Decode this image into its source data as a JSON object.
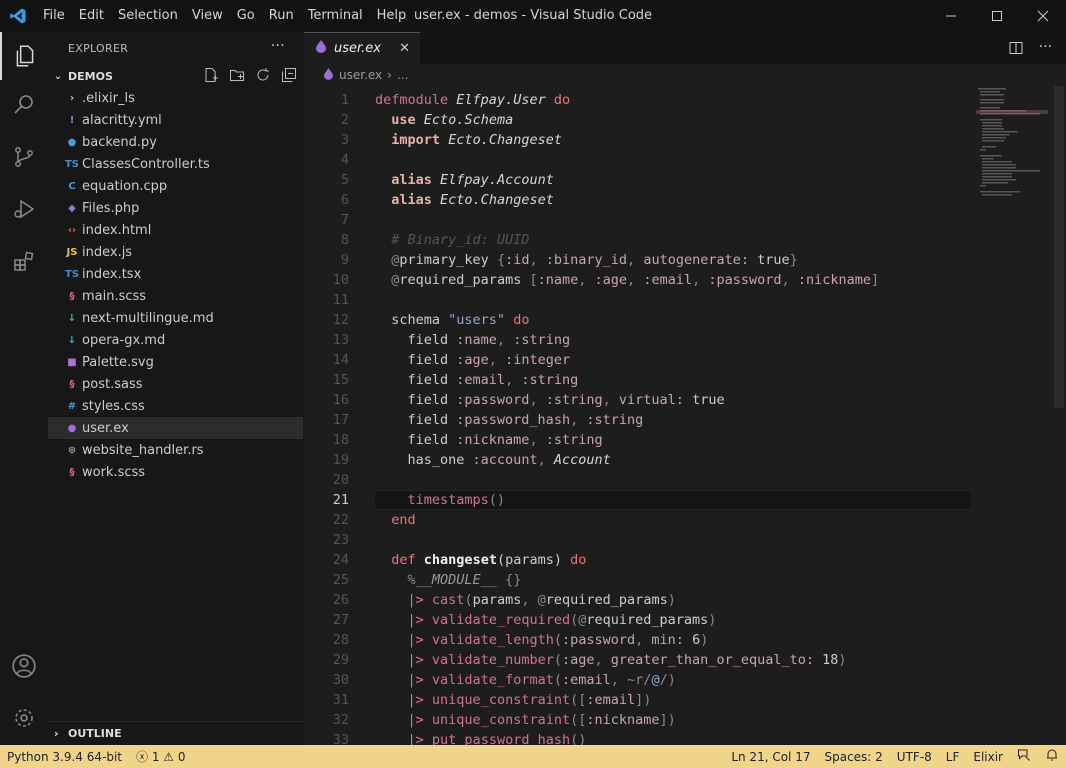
{
  "window": {
    "title": "user.ex - demos - Visual Studio Code"
  },
  "menu": [
    "File",
    "Edit",
    "Selection",
    "View",
    "Go",
    "Run",
    "Terminal",
    "Help"
  ],
  "explorer": {
    "header": "EXPLORER",
    "folder": "DEMOS",
    "files": [
      {
        "name": ".elixir_ls",
        "icon": "chevron-right",
        "color": "#cccccc"
      },
      {
        "name": "alacritty.yml",
        "icon": "exclamation",
        "color": "#9b7fd4"
      },
      {
        "name": "backend.py",
        "icon": "python",
        "color": "#4a9bd4"
      },
      {
        "name": "ClassesController.ts",
        "icon": "TS",
        "color": "#3b8fcf"
      },
      {
        "name": "equation.cpp",
        "icon": "C",
        "color": "#4a90d9"
      },
      {
        "name": "Files.php",
        "icon": "php",
        "color": "#8a7fd4"
      },
      {
        "name": "index.html",
        "icon": "<>",
        "color": "#e5674b"
      },
      {
        "name": "index.js",
        "icon": "JS",
        "color": "#e8c547"
      },
      {
        "name": "index.tsx",
        "icon": "TS",
        "color": "#3b8fcf"
      },
      {
        "name": "main.scss",
        "icon": "sass",
        "color": "#d9689b"
      },
      {
        "name": "next-multilingue.md",
        "icon": "down-arrow",
        "color": "#4aa5d9"
      },
      {
        "name": "opera-gx.md",
        "icon": "down-arrow",
        "color": "#4aa5d9"
      },
      {
        "name": "Palette.svg",
        "icon": "svg",
        "color": "#b06fd9"
      },
      {
        "name": "post.sass",
        "icon": "sass",
        "color": "#d9689b"
      },
      {
        "name": "styles.css",
        "icon": "#",
        "color": "#4a9bd4"
      },
      {
        "name": "user.ex",
        "icon": "drop",
        "color": "#9b6fd4",
        "selected": true
      },
      {
        "name": "website_handler.rs",
        "icon": "rust",
        "color": "#999999"
      },
      {
        "name": "work.scss",
        "icon": "sass",
        "color": "#d9689b"
      }
    ],
    "outline": "OUTLINE"
  },
  "tab": {
    "label": "user.ex",
    "close": "✕"
  },
  "breadcrumb": {
    "file": "user.ex",
    "rest": "..."
  },
  "code": {
    "current_line": 21,
    "lines": [
      "<span class='f'>defmodule</span> <span class='t'>Elfpay.User</span> <span class='k'>do</span>",
      "  <span class='kw'>use</span> <span class='t'>Ecto.Schema</span>",
      "  <span class='kw'>import</span> <span class='t'>Ecto.Changeset</span>",
      "",
      "  <span class='kw'>alias</span> <span class='t'>Elfpay.Account</span>",
      "  <span class='kw'>alias</span> <span class='t'>Ecto.Changeset</span>",
      "",
      "  <span class='cm'># Binary_id: UUID</span>",
      "  <span class='p'>@</span>primary_key <span class='p'>{</span><span class='a'>:id</span><span class='p'>,</span> <span class='a'>:binary_id</span><span class='p'>,</span> <span class='a'>autogenerate:</span> true<span class='p'>}</span>",
      "  <span class='p'>@</span>required_params <span class='p'>[</span><span class='a'>:name</span><span class='p'>,</span> <span class='a'>:age</span><span class='p'>,</span> <span class='a'>:email</span><span class='p'>,</span> <span class='a'>:password</span><span class='p'>,</span> <span class='a'>:nickname</span><span class='p'>]</span>",
      "",
      "  schema <span class='s'>\"users\"</span> <span class='k'>do</span>",
      "    field <span class='a'>:name</span><span class='p'>,</span> <span class='a'>:string</span>",
      "    field <span class='a'>:age</span><span class='p'>,</span> <span class='a'>:integer</span>",
      "    field <span class='a'>:email</span><span class='p'>,</span> <span class='a'>:string</span>",
      "    field <span class='a'>:password</span><span class='p'>,</span> <span class='a'>:string</span><span class='p'>,</span> <span class='a'>virtual:</span> true",
      "    field <span class='a'>:password_hash</span><span class='p'>,</span> <span class='a'>:string</span>",
      "    field <span class='a'>:nickname</span><span class='p'>,</span> <span class='a'>:string</span>",
      "    has_one <span class='a'>:account</span><span class='p'>,</span> <span class='t'>Account</span>",
      "",
      "    <span class='f'>timestamps</span><span class='p'>()</span>",
      "  <span class='k'>end</span>",
      "",
      "  <span class='k'>def</span> <span class='b'>changeset</span>(params) <span class='k'>do</span>",
      "    <span class='p'>%</span><span class='m'>__MODULE__</span> <span class='p'>{}</span>",
      "    <span class='k'>|&gt;</span> <span class='f'>cast</span><span class='p'>(</span>params<span class='p'>,</span> <span class='p'>@</span>required_params<span class='p'>)</span>",
      "    <span class='k'>|&gt;</span> <span class='f'>validate_required</span><span class='p'>(@</span>required_params<span class='p'>)</span>",
      "    <span class='k'>|&gt;</span> <span class='f'>validate_length</span><span class='p'>(</span><span class='a'>:password</span><span class='p'>,</span> <span class='a'>min:</span> 6<span class='p'>)</span>",
      "    <span class='k'>|&gt;</span> <span class='f'>validate_number</span><span class='p'>(</span><span class='a'>:age</span><span class='p'>,</span> <span class='a'>greater_than_or_equal_to:</span> 18<span class='p'>)</span>",
      "    <span class='k'>|&gt;</span> <span class='f'>validate_format</span><span class='p'>(</span><span class='a'>:email</span><span class='p'>,</span> <span class='p'>~r/</span><span class='s'>@</span><span class='p'>/)</span>",
      "    <span class='k'>|&gt;</span> <span class='f'>unique_constraint</span><span class='p'>([</span><span class='a'>:email</span><span class='p'>])</span>",
      "    <span class='k'>|&gt;</span> <span class='f'>unique_constraint</span><span class='p'>([</span><span class='a'>:nickname</span><span class='p'>])</span>",
      "    <span class='k'>|&gt;</span> <span class='f'>put_password_hash</span><span class='p'>()</span>"
    ]
  },
  "status": {
    "python": "Python 3.9.4 64-bit",
    "problems": "ⓧ 1 ⚠ 0",
    "position": "Ln 21, Col 17",
    "spaces": "Spaces: 2",
    "encoding": "UTF-8",
    "eol": "LF",
    "language": "Elixir"
  },
  "colors": {
    "accent": "#f0d48a",
    "background": "#1d1d1d"
  }
}
